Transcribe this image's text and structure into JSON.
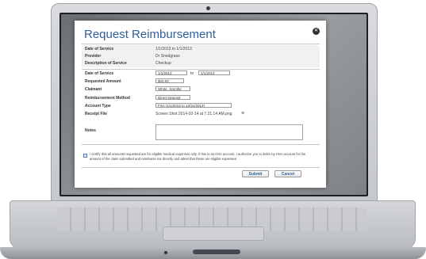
{
  "dialog": {
    "title": "Request Reimbursement",
    "close_icon": "close-icon",
    "summary": [
      {
        "label": "Date of Service",
        "value": "1/1/2013 to 1/1/2013"
      },
      {
        "label": "Provider",
        "value": "Dr Snodgrass"
      },
      {
        "label": "Description of Service",
        "value": "Checkup"
      }
    ],
    "form": {
      "date_of_service_label": "Date of Service",
      "date_from": "1/1/2013",
      "date_to_word": "to",
      "date_to": "1/1/2013",
      "requested_amount_label": "Requested Amount",
      "requested_amount_value": "$20.00",
      "claimant_label": "Claimant",
      "claimant_value": "White, Jennifer",
      "method_label": "Reimbursement Method",
      "method_value": "Direct Deposit",
      "account_type_label": "Account Type",
      "account_type_value": "FSA (1/1/2013 to 12/31/2013)",
      "receipt_label": "Receipt File",
      "receipt_file": "Screen Shot 2014-02-14 at 7.21.14 AM.png",
      "receipt_icon": "attachment-icon",
      "notes_label": "Notes",
      "notes_value": ""
    },
    "certification": "I certify that all amounts requested are for eligible medical expenses only. If this is an HSA account, I authorize you to debit my HSA account for the amount of the claim submitted and reimburse me directly and attest that these are eligible expenses.",
    "submit_label": "Submit",
    "cancel_label": "Cancel"
  },
  "colors": {
    "accent": "#2f5f97",
    "check": "#4a7fb7"
  }
}
